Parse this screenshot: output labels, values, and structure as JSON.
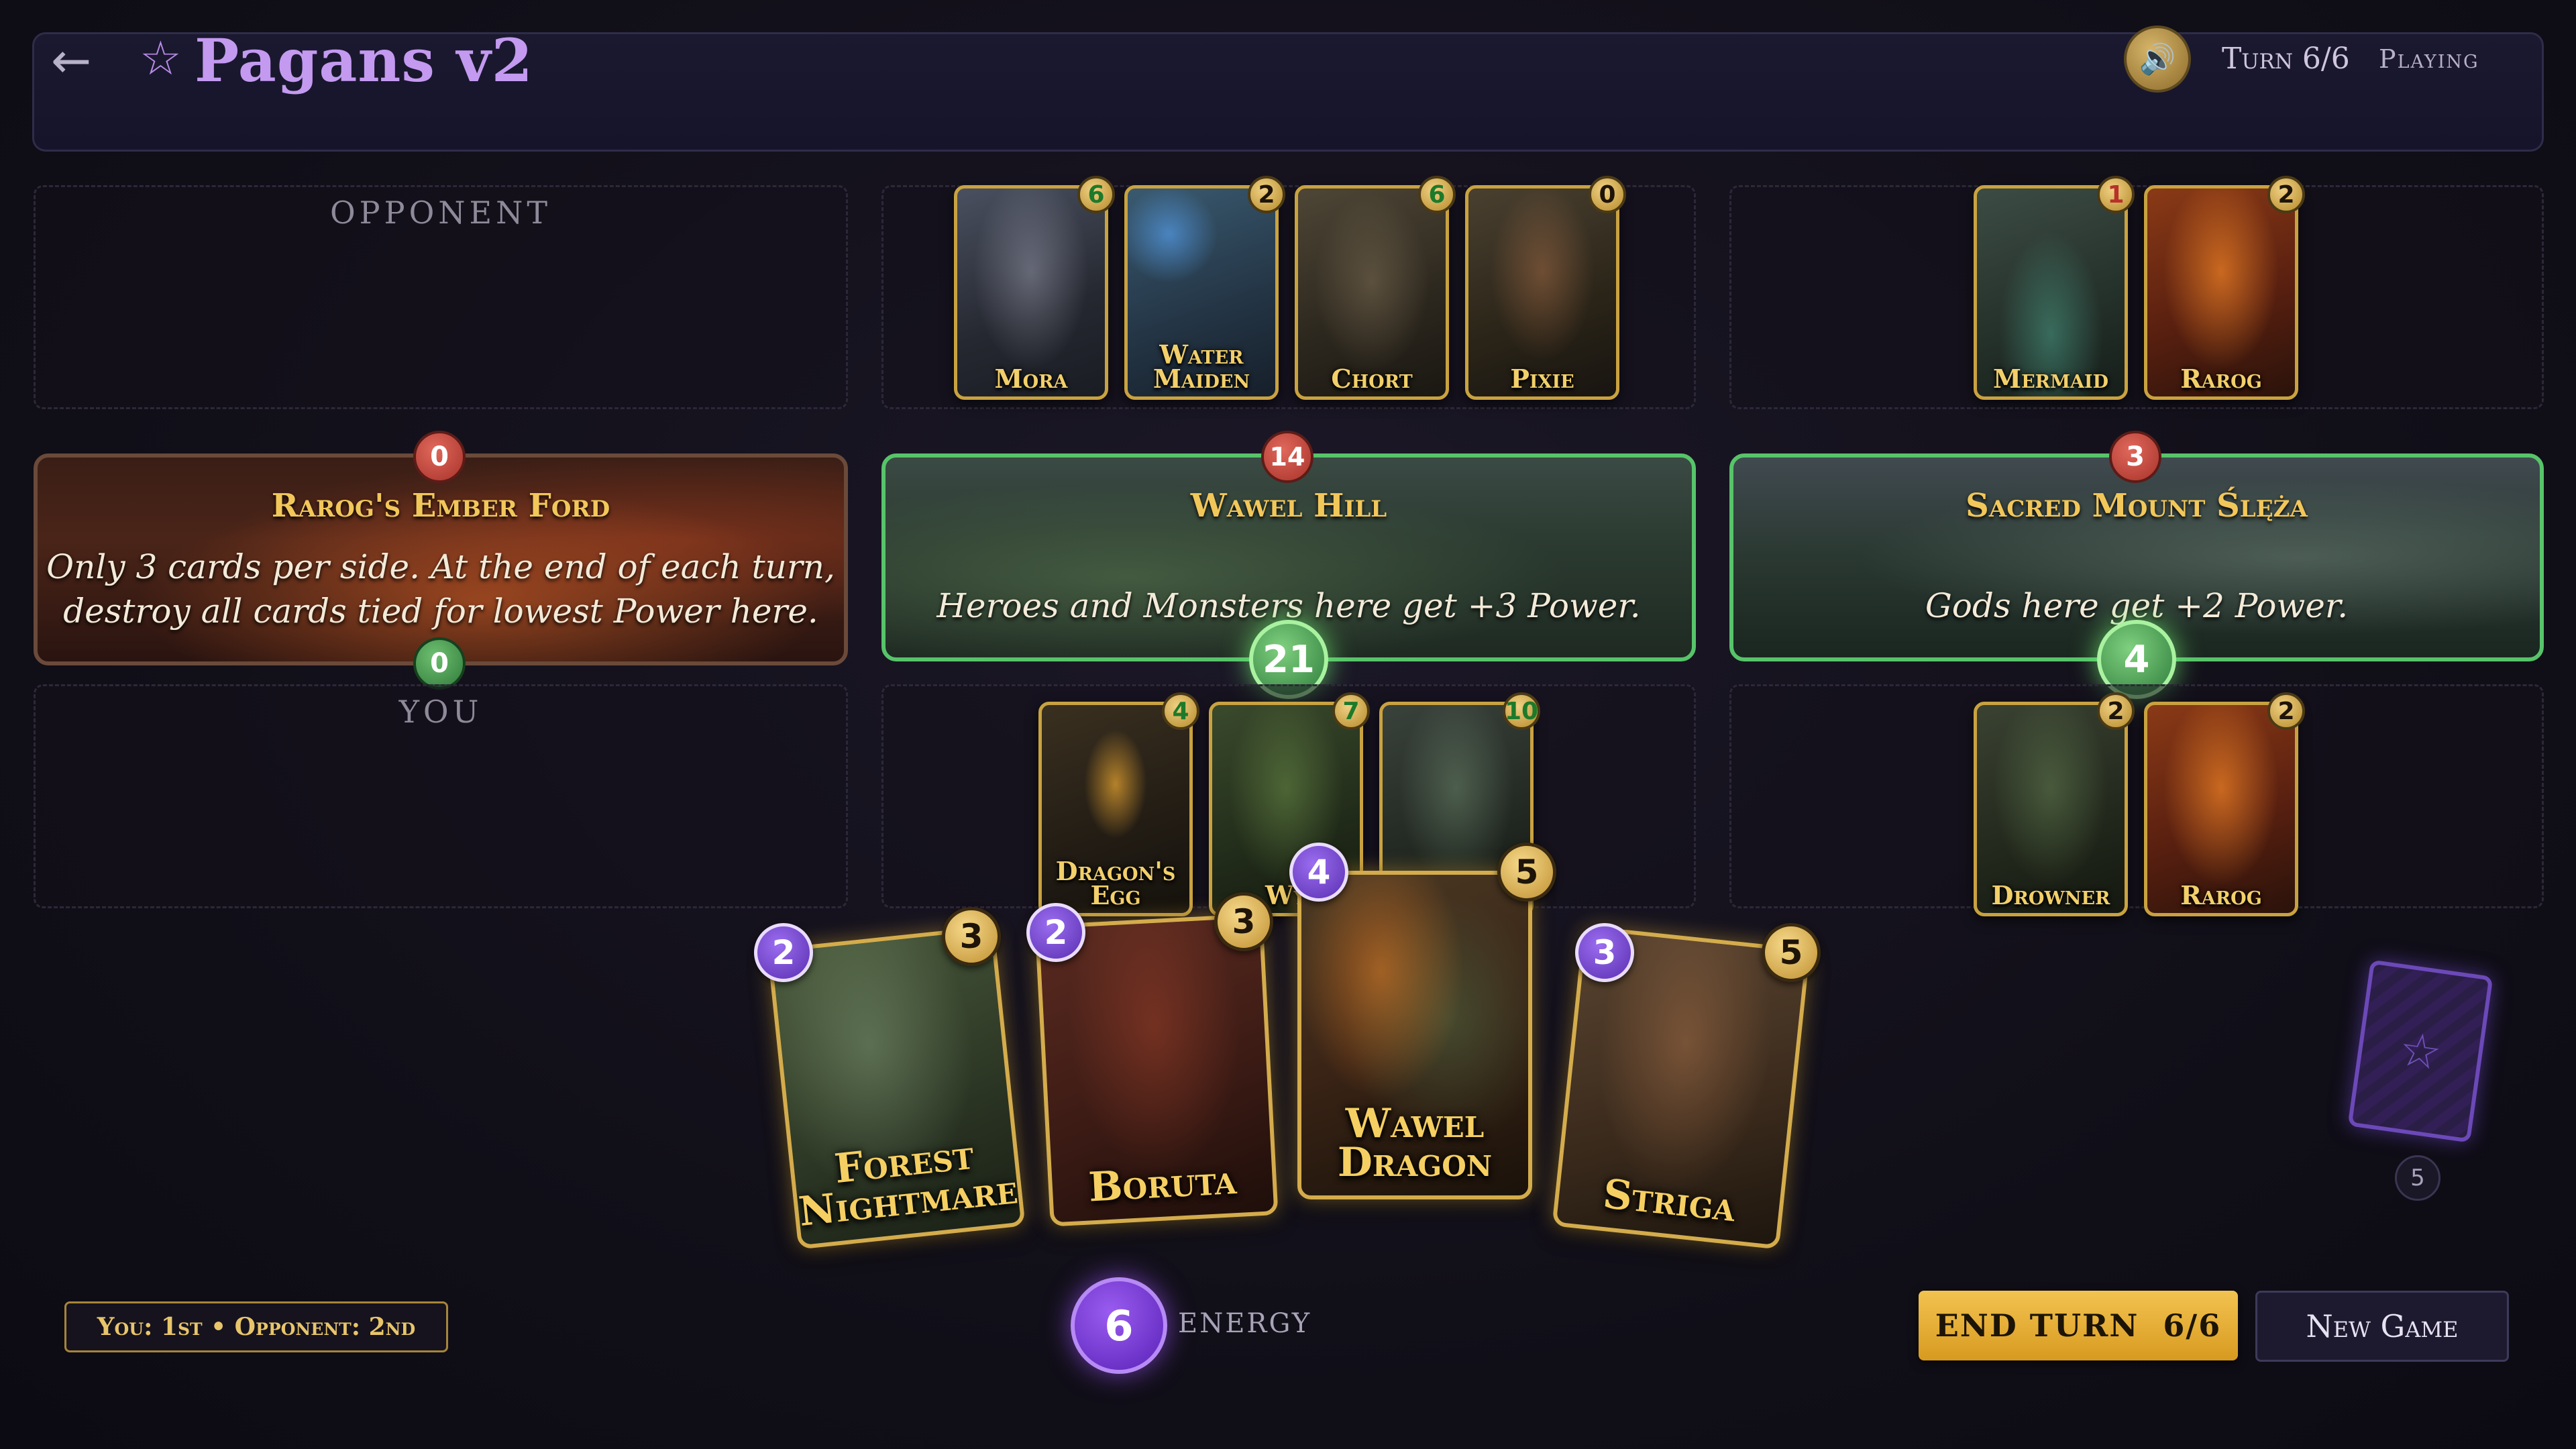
{
  "header": {
    "back_icon": "←",
    "title_icon": "☆",
    "title": "Pagans v2",
    "sound_icon": "🔊",
    "turn": "Turn 6/6",
    "status": "Playing"
  },
  "labels": {
    "opponent": "OPPONENT",
    "you": "YOU"
  },
  "locations": [
    {
      "name": "Rarog's Ember Ford",
      "desc_line1": "Only 3 cards per side. At the end of each turn,",
      "desc_line2": "destroy all cards tied for lowest Power here.",
      "opponent_power": "0",
      "player_power": "0"
    },
    {
      "name": "Wawel Hill",
      "desc": "Heroes and Monsters here get +3 Power.",
      "opponent_power": "14",
      "player_power": "21"
    },
    {
      "name": "Sacred Mount Ślęża",
      "desc": "Gods here get +2 Power.",
      "opponent_power": "3",
      "player_power": "4"
    }
  ],
  "opponent_board": {
    "wawel": [
      {
        "name_line1": "Mora",
        "name_line2": "",
        "power": "6"
      },
      {
        "name_line1": "Water",
        "name_line2": "Maiden",
        "power": "2"
      },
      {
        "name_line1": "Chort",
        "name_line2": "",
        "power": "6"
      },
      {
        "name_line1": "Pixie",
        "name_line2": "",
        "power": "0"
      }
    ],
    "sleza": [
      {
        "name_line1": "Mermaid",
        "name_line2": "",
        "power": "1"
      },
      {
        "name_line1": "Rarog",
        "name_line2": "",
        "power": "2"
      }
    ]
  },
  "player_board": {
    "wawel": [
      {
        "name_line1": "Dragon's",
        "name_line2": "Egg",
        "power": "4"
      },
      {
        "name_line1": "Wy",
        "name_line2": "",
        "power": "7"
      },
      {
        "name_line1": "",
        "name_line2": "",
        "power": "10"
      }
    ],
    "sleza": [
      {
        "name_line1": "Drowner",
        "name_line2": "",
        "power": "2"
      },
      {
        "name_line1": "Rarog",
        "name_line2": "",
        "power": "2"
      }
    ]
  },
  "hand": [
    {
      "name_line1": "Forest",
      "name_line2": "Nightmare",
      "cost": "2",
      "power": "3"
    },
    {
      "name_line1": "Boruta",
      "name_line2": "",
      "cost": "2",
      "power": "3"
    },
    {
      "name_line1": "Wawel",
      "name_line2": "Dragon",
      "cost": "4",
      "power": "5"
    },
    {
      "name_line1": "Striga",
      "name_line2": "",
      "cost": "3",
      "power": "5"
    }
  ],
  "deck": {
    "icon": "☆",
    "count": "5"
  },
  "footer": {
    "order": "You: 1st • Opponent: 2nd",
    "energy": "6",
    "energy_label": "ENERGY",
    "end_turn": "END TURN  6/6",
    "new_game": "New Game"
  },
  "colors": {
    "gold": "#f2c75a",
    "purple": "#c39af0",
    "green_border": "#57c46a",
    "red_badge": "#c0463a"
  }
}
